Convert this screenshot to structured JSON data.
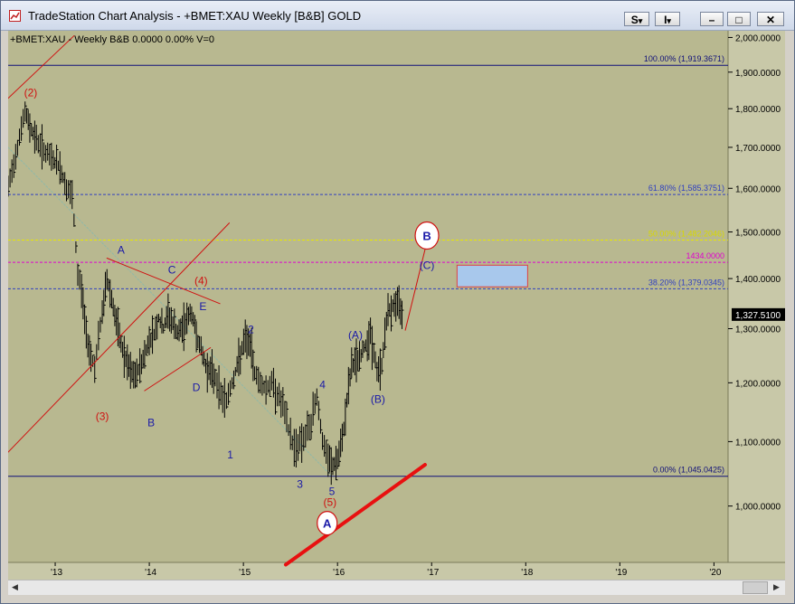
{
  "window": {
    "title": "TradeStation Chart Analysis - +BMET:XAU Weekly [B&B] GOLD",
    "btn_s": "S",
    "btn_i": "I",
    "btn_dropdown": "▾",
    "btn_min": "–",
    "btn_max": "□",
    "btn_close": "✕"
  },
  "colors": {
    "plot_bg": "#b8b890",
    "axis_bg": "#c8c8a8",
    "price": "#000000",
    "wave_blue": "#1a1aa8",
    "wave_red": "#d01010",
    "fib_navy": "#10107a",
    "fib_blue": "#3040c0",
    "fib_yellow": "#e8e800",
    "magenta": "#e000d0",
    "box_fill": "#a8c8ec",
    "box_border": "#e04040"
  },
  "chart_data": {
    "type": "line",
    "symbol_label": "+BMET:XAU - Weekly  B&B  0.0000  0.00%  V=0",
    "xlabel": "",
    "ylabel": "",
    "xlim": [
      2012.5,
      2020.15
    ],
    "ylim": [
      920,
      2020
    ],
    "y_scale": "log",
    "x_ticks": [
      {
        "x": 2013,
        "label": "'13"
      },
      {
        "x": 2014,
        "label": "'14"
      },
      {
        "x": 2015,
        "label": "'15"
      },
      {
        "x": 2016,
        "label": "'16"
      },
      {
        "x": 2017,
        "label": "'17"
      },
      {
        "x": 2018,
        "label": "'18"
      },
      {
        "x": 2019,
        "label": "'19"
      },
      {
        "x": 2020,
        "label": "'20"
      }
    ],
    "y_ticks": [
      {
        "y": 2000,
        "label": "2,000.0000"
      },
      {
        "y": 1900,
        "label": "1,900.0000"
      },
      {
        "y": 1800,
        "label": "1,800.0000"
      },
      {
        "y": 1700,
        "label": "1,700.0000"
      },
      {
        "y": 1600,
        "label": "1,600.0000"
      },
      {
        "y": 1500,
        "label": "1,500.0000"
      },
      {
        "y": 1400,
        "label": "1,400.0000"
      },
      {
        "y": 1300,
        "label": "1,300.0000"
      },
      {
        "y": 1200,
        "label": "1,200.0000"
      },
      {
        "y": 1100,
        "label": "1,100.0000"
      },
      {
        "y": 1000,
        "label": "1,000.0000"
      }
    ],
    "last_price": {
      "value": 1327.51,
      "label": "1,327.5100"
    },
    "series": [
      {
        "x": [
          2012.5,
          2012.56,
          2012.62,
          2012.68,
          2012.73,
          2012.8,
          2012.86,
          2012.92,
          2012.98,
          2013.05,
          2013.12,
          2013.18,
          2013.24,
          2013.28,
          2013.33,
          2013.38,
          2013.42,
          2013.46,
          2013.5,
          2013.55,
          2013.6,
          2013.65,
          2013.7,
          2013.75,
          2013.8,
          2013.85,
          2013.9,
          2013.95,
          2014.0,
          2014.05,
          2014.1,
          2014.15,
          2014.2,
          2014.25,
          2014.3,
          2014.35,
          2014.4,
          2014.45,
          2014.5,
          2014.55,
          2014.6,
          2014.65,
          2014.7,
          2014.76,
          2014.82,
          2014.88,
          2014.95,
          2015.02,
          2015.07,
          2015.12,
          2015.18,
          2015.24,
          2015.3,
          2015.36,
          2015.42,
          2015.48,
          2015.54,
          2015.6,
          2015.66,
          2015.72,
          2015.78,
          2015.84,
          2015.9,
          2015.95,
          2016.0,
          2016.05,
          2016.1,
          2016.15,
          2016.2,
          2016.25,
          2016.3,
          2016.35,
          2016.42,
          2016.47,
          2016.52,
          2016.57,
          2016.62,
          2016.67,
          2016.7
        ],
        "y": [
          1600,
          1660,
          1730,
          1790,
          1755,
          1720,
          1700,
          1680,
          1670,
          1650,
          1600,
          1580,
          1410,
          1380,
          1290,
          1250,
          1230,
          1280,
          1330,
          1400,
          1360,
          1310,
          1270,
          1240,
          1220,
          1210,
          1230,
          1250,
          1280,
          1290,
          1320,
          1300,
          1330,
          1310,
          1290,
          1300,
          1320,
          1330,
          1290,
          1260,
          1230,
          1220,
          1210,
          1180,
          1170,
          1200,
          1240,
          1280,
          1270,
          1220,
          1200,
          1190,
          1200,
          1180,
          1160,
          1120,
          1090,
          1100,
          1110,
          1130,
          1180,
          1100,
          1070,
          1060,
          1070,
          1100,
          1170,
          1230,
          1240,
          1250,
          1270,
          1290,
          1220,
          1230,
          1320,
          1340,
          1350,
          1340,
          1327
        ]
      }
    ],
    "fib_levels": [
      {
        "y": 1919.3671,
        "label": "100.00% (1,919.3671)",
        "style": "solid",
        "color": "#10107a"
      },
      {
        "y": 1585.3751,
        "label": "61.80% (1,585.3751)",
        "style": "dashed",
        "color": "#3040c0"
      },
      {
        "y": 1482.2046,
        "label": "50.00% (1,482.2046)",
        "style": "dashed",
        "color": "#e8e800"
      },
      {
        "y": 1434,
        "label": "1434.0000",
        "style": "dashed",
        "color": "#e000d0"
      },
      {
        "y": 1379.0345,
        "label": "38.20% (1,379.0345)",
        "style": "dashed",
        "color": "#3040c0"
      },
      {
        "y": 1045.0425,
        "label": "0.00% (1,045.0425)",
        "style": "solid",
        "color": "#10107a"
      }
    ],
    "wave_labels": [
      {
        "text": "(2)",
        "x": 2012.74,
        "y": 1845,
        "color": "#d01010",
        "circled": false
      },
      {
        "text": "A",
        "x": 2013.7,
        "y": 1462,
        "color": "#1a1aa8",
        "circled": false
      },
      {
        "text": "C",
        "x": 2014.24,
        "y": 1420,
        "color": "#1a1aa8",
        "circled": false
      },
      {
        "text": "(4)",
        "x": 2014.55,
        "y": 1397,
        "color": "#d01010",
        "circled": false
      },
      {
        "text": "E",
        "x": 2014.57,
        "y": 1345,
        "color": "#1a1aa8",
        "circled": false
      },
      {
        "text": "2",
        "x": 2015.08,
        "y": 1300,
        "color": "#1a1aa8",
        "circled": false
      },
      {
        "text": "D",
        "x": 2014.5,
        "y": 1193,
        "color": "#1a1aa8",
        "circled": false
      },
      {
        "text": "(3)",
        "x": 2013.5,
        "y": 1143,
        "color": "#d01010",
        "circled": false
      },
      {
        "text": "B",
        "x": 2014.02,
        "y": 1133,
        "color": "#1a1aa8",
        "circled": false
      },
      {
        "text": "1",
        "x": 2014.86,
        "y": 1080,
        "color": "#1a1aa8",
        "circled": false
      },
      {
        "text": "4",
        "x": 2015.84,
        "y": 1198,
        "color": "#1a1aa8",
        "circled": false
      },
      {
        "text": "3",
        "x": 2015.6,
        "y": 1034,
        "color": "#1a1aa8",
        "circled": false
      },
      {
        "text": "5",
        "x": 2015.94,
        "y": 1023,
        "color": "#1a1aa8",
        "circled": false
      },
      {
        "text": "(5)",
        "x": 2015.92,
        "y": 1007,
        "color": "#d01010",
        "circled": false
      },
      {
        "text": "(A)",
        "x": 2016.19,
        "y": 1290,
        "color": "#1a1aa8",
        "circled": false
      },
      {
        "text": "(B)",
        "x": 2016.43,
        "y": 1173,
        "color": "#1a1aa8",
        "circled": false
      },
      {
        "text": "(C)",
        "x": 2016.95,
        "y": 1430,
        "color": "#1a1aa8",
        "circled": false
      },
      {
        "text": "B",
        "x": 2016.95,
        "y": 1492,
        "color": "#1a1aa8",
        "circled": true
      },
      {
        "text": "A",
        "x": 2015.89,
        "y": 975,
        "color": "#1a1aa8",
        "circled": true
      }
    ],
    "trendlines": [
      {
        "x1": 2012.5,
        "y1": 1828,
        "x2": 2013.2,
        "y2": 2005,
        "color": "#d01010",
        "width": 1
      },
      {
        "x1": 2012.5,
        "y1": 1083,
        "x2": 2014.85,
        "y2": 1520,
        "color": "#d01010",
        "width": 1
      },
      {
        "x1": 2013.55,
        "y1": 1443,
        "x2": 2014.75,
        "y2": 1349,
        "color": "#d01010",
        "width": 1
      },
      {
        "x1": 2013.95,
        "y1": 1186,
        "x2": 2014.65,
        "y2": 1264,
        "color": "#d01010",
        "width": 1
      },
      {
        "x1": 2015.45,
        "y1": 917,
        "x2": 2016.93,
        "y2": 1063,
        "color": "#e81010",
        "width": 4
      },
      {
        "x1": 2016.72,
        "y1": 1297,
        "x2": 2016.94,
        "y2": 1470,
        "color": "#d01010",
        "width": 1
      },
      {
        "x1": 2012.5,
        "y1": 1700,
        "x2": 2015.94,
        "y2": 1045,
        "color": "#8fb8a8",
        "width": 1,
        "dashed": true
      }
    ],
    "target_box": {
      "x1": 2017.27,
      "x2": 2018.02,
      "y1": 1428,
      "y2": 1383
    }
  }
}
